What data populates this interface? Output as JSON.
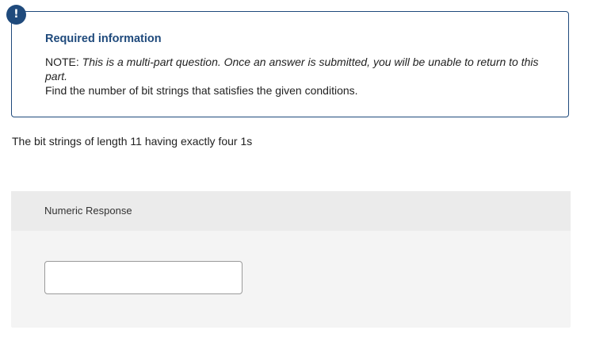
{
  "alert": {
    "icon": "exclamation-icon",
    "glyph": "!",
    "color": "#1f4a7c"
  },
  "info": {
    "title": "Required information",
    "note_prefix": "NOTE: ",
    "note_body": "This is a multi-part question. Once an answer is submitted, you will be unable to return to this part.",
    "instruction": "Find the number of bit strings that satisfies the given conditions."
  },
  "question": {
    "text": "The bit strings of length 11 having exactly four 1s"
  },
  "response": {
    "label": "Numeric Response",
    "value": ""
  }
}
